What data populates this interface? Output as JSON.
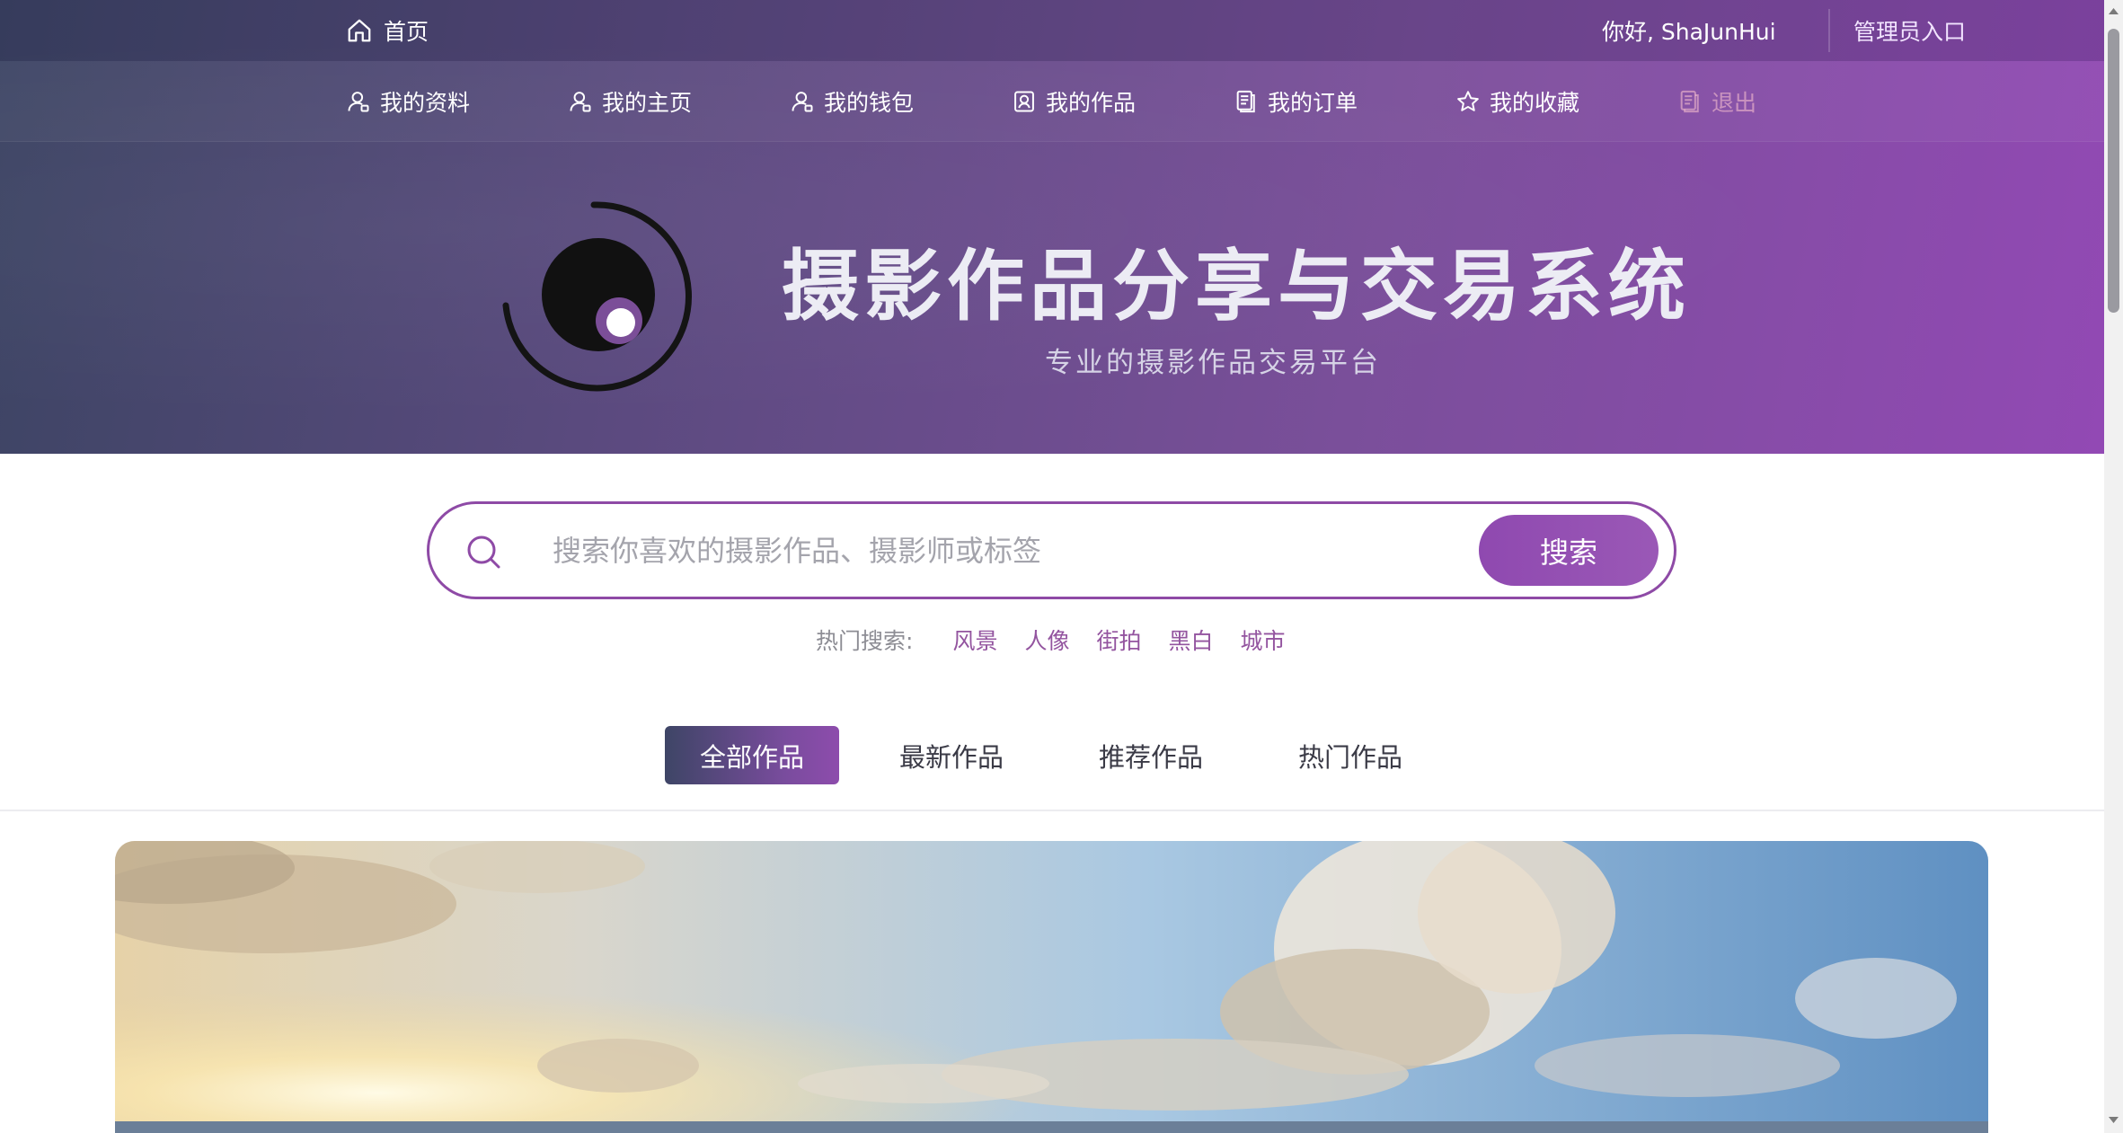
{
  "topbar": {
    "home_label": "首页",
    "greeting": "你好, ShaJunHui",
    "admin_link": "管理员入口"
  },
  "nav": {
    "items": [
      {
        "label": "我的资料",
        "icon": "user-icon"
      },
      {
        "label": "我的主页",
        "icon": "user-icon"
      },
      {
        "label": "我的钱包",
        "icon": "user-icon"
      },
      {
        "label": "我的作品",
        "icon": "photo-frame-icon"
      },
      {
        "label": "我的订单",
        "icon": "document-icon"
      },
      {
        "label": "我的收藏",
        "icon": "star-icon"
      },
      {
        "label": "退出",
        "icon": "document-icon"
      }
    ]
  },
  "hero": {
    "title": "摄影作品分享与交易系统",
    "subtitle": "专业的摄影作品交易平台"
  },
  "search": {
    "placeholder": "搜索你喜欢的摄影作品、摄影师或标签",
    "value": "",
    "button_label": "搜索"
  },
  "hot_search": {
    "label": "热门搜索:",
    "tags": [
      "风景",
      "人像",
      "街拍",
      "黑白",
      "城市"
    ]
  },
  "tabs": [
    {
      "label": "全部作品",
      "active": true
    },
    {
      "label": "最新作品",
      "active": false
    },
    {
      "label": "推荐作品",
      "active": false
    },
    {
      "label": "热门作品",
      "active": false
    }
  ],
  "colors": {
    "header_gradient_start": "#3c4463",
    "header_gradient_end": "#9249b4",
    "accent_purple": "#8e4aa6",
    "hot_tag": "#93549f",
    "active_tab_start": "#3e4566",
    "active_tab_end": "#8d4cac"
  }
}
